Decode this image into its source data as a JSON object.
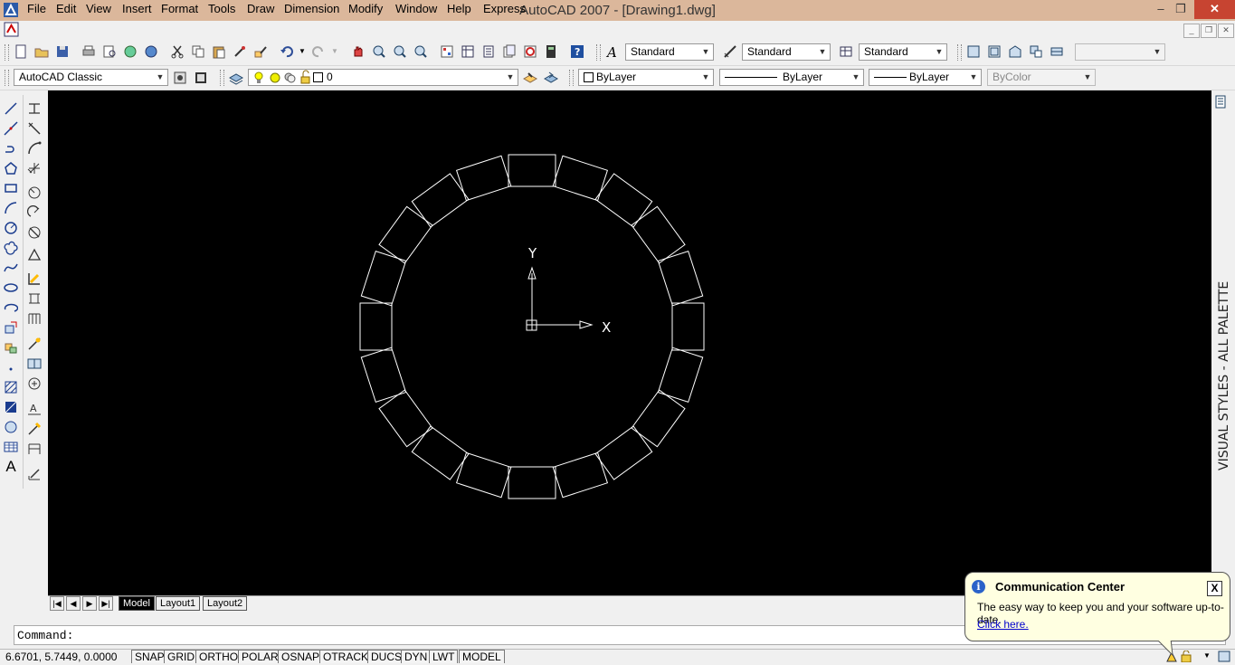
{
  "window": {
    "title": "AutoCAD 2007 - [Drawing1.dwg]",
    "minimize": "–",
    "restore": "❐",
    "close": "✕"
  },
  "menu": [
    "File",
    "Edit",
    "View",
    "Insert",
    "Format",
    "Tools",
    "Draw",
    "Dimension",
    "Modify",
    "Window",
    "Help",
    "Express"
  ],
  "styles_toolbar": {
    "text_style": "Standard",
    "dim_style": "Standard",
    "table_style": "Standard"
  },
  "workspace": "AutoCAD Classic",
  "layer": {
    "current": "0"
  },
  "properties": {
    "color": "ByLayer",
    "linetype": "ByLayer",
    "lineweight": "ByLayer",
    "plot_style": "ByColor"
  },
  "drawing": {
    "ucs_x": "X",
    "ucs_y": "Y"
  },
  "tabs": {
    "model": "Model",
    "layout1": "Layout1",
    "layout2": "Layout2"
  },
  "command": {
    "prompt": "Command:"
  },
  "status": {
    "coordinates": "6.6701,  5.7449,  0.0000",
    "toggles": [
      "SNAP",
      "GRID",
      "ORTHO",
      "POLAR",
      "OSNAP",
      "OTRACK",
      "DUCS",
      "DYN",
      "LWT",
      "MODEL"
    ]
  },
  "palette": {
    "label": "VISUAL STYLES - ALL PALETTES"
  },
  "balloon": {
    "title": "Communication Center",
    "text": "The easy way to keep you and your software up-to-date.",
    "link": "Click here.",
    "close": "X",
    "info": "i"
  }
}
